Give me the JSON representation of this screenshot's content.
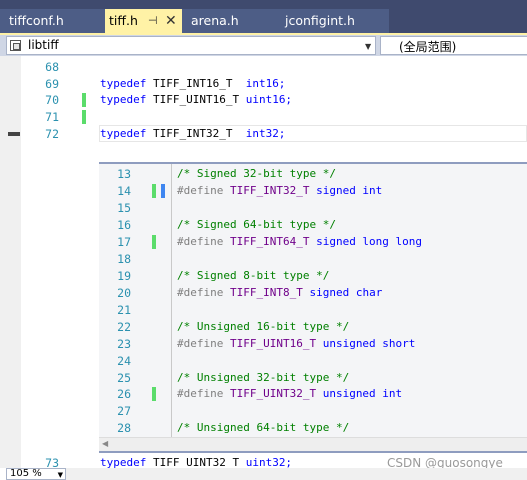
{
  "tabs": [
    {
      "label": "tiffconf.h",
      "active": false
    },
    {
      "label": "tiff.h",
      "active": true
    },
    {
      "label": "arena.h",
      "active": false
    },
    {
      "label": "jconfigint.h",
      "active": false
    }
  ],
  "tab_icons": {
    "pin": "pin-icon",
    "close": "close-icon"
  },
  "nav": {
    "project": "libtiff",
    "scope": "(全局范围)"
  },
  "editor": {
    "lines": [
      {
        "num": "68",
        "kw": "",
        "name": "",
        "type": ""
      },
      {
        "num": "69",
        "kw": "typedef",
        "name": " TIFF_INT16_T",
        "type": "  int16;"
      },
      {
        "num": "70",
        "kw": "typedef",
        "name": " TIFF_UINT16_T",
        "type": " uint16;"
      },
      {
        "num": "71",
        "kw": "",
        "name": "",
        "type": ""
      },
      {
        "num": "72",
        "kw": "typedef",
        "name": " TIFF_INT32_T",
        "type": "  int32;"
      }
    ],
    "after_peek": {
      "num": "73",
      "kw": "typedef",
      "name": " TIFF_UINT32_T",
      "type": " uint32;"
    }
  },
  "peek": {
    "lines": [
      {
        "num": "13",
        "comment": "/* Signed 32-bit type */"
      },
      {
        "num": "14",
        "define": "#define",
        "macro": " TIFF_INT32_T",
        "value": " signed int"
      },
      {
        "num": "15"
      },
      {
        "num": "16",
        "comment": "/* Signed 64-bit type */"
      },
      {
        "num": "17",
        "define": "#define",
        "macro": " TIFF_INT64_T",
        "value": " signed long long"
      },
      {
        "num": "18"
      },
      {
        "num": "19",
        "comment": "/* Signed 8-bit type */"
      },
      {
        "num": "20",
        "define": "#define",
        "macro": " TIFF_INT8_T",
        "value": " signed char"
      },
      {
        "num": "21"
      },
      {
        "num": "22",
        "comment": "/* Unsigned 16-bit type */"
      },
      {
        "num": "23",
        "define": "#define",
        "macro": " TIFF_UINT16_T",
        "value": " unsigned short"
      },
      {
        "num": "24"
      },
      {
        "num": "25",
        "comment": "/* Unsigned 32-bit type */"
      },
      {
        "num": "26",
        "define": "#define",
        "macro": " TIFF_UINT32_T",
        "value": " unsigned int"
      },
      {
        "num": "27"
      },
      {
        "num": "28",
        "comment": "/* Unsigned 64-bit type */"
      }
    ]
  },
  "zoom": "105 %",
  "watermark": "CSDN @guosongye",
  "colors": {
    "keyword": "#0000ff",
    "comment": "#008000",
    "macro": "#6f008a",
    "line_number": "#2b91af",
    "change_bar": "#5bdc6b"
  }
}
